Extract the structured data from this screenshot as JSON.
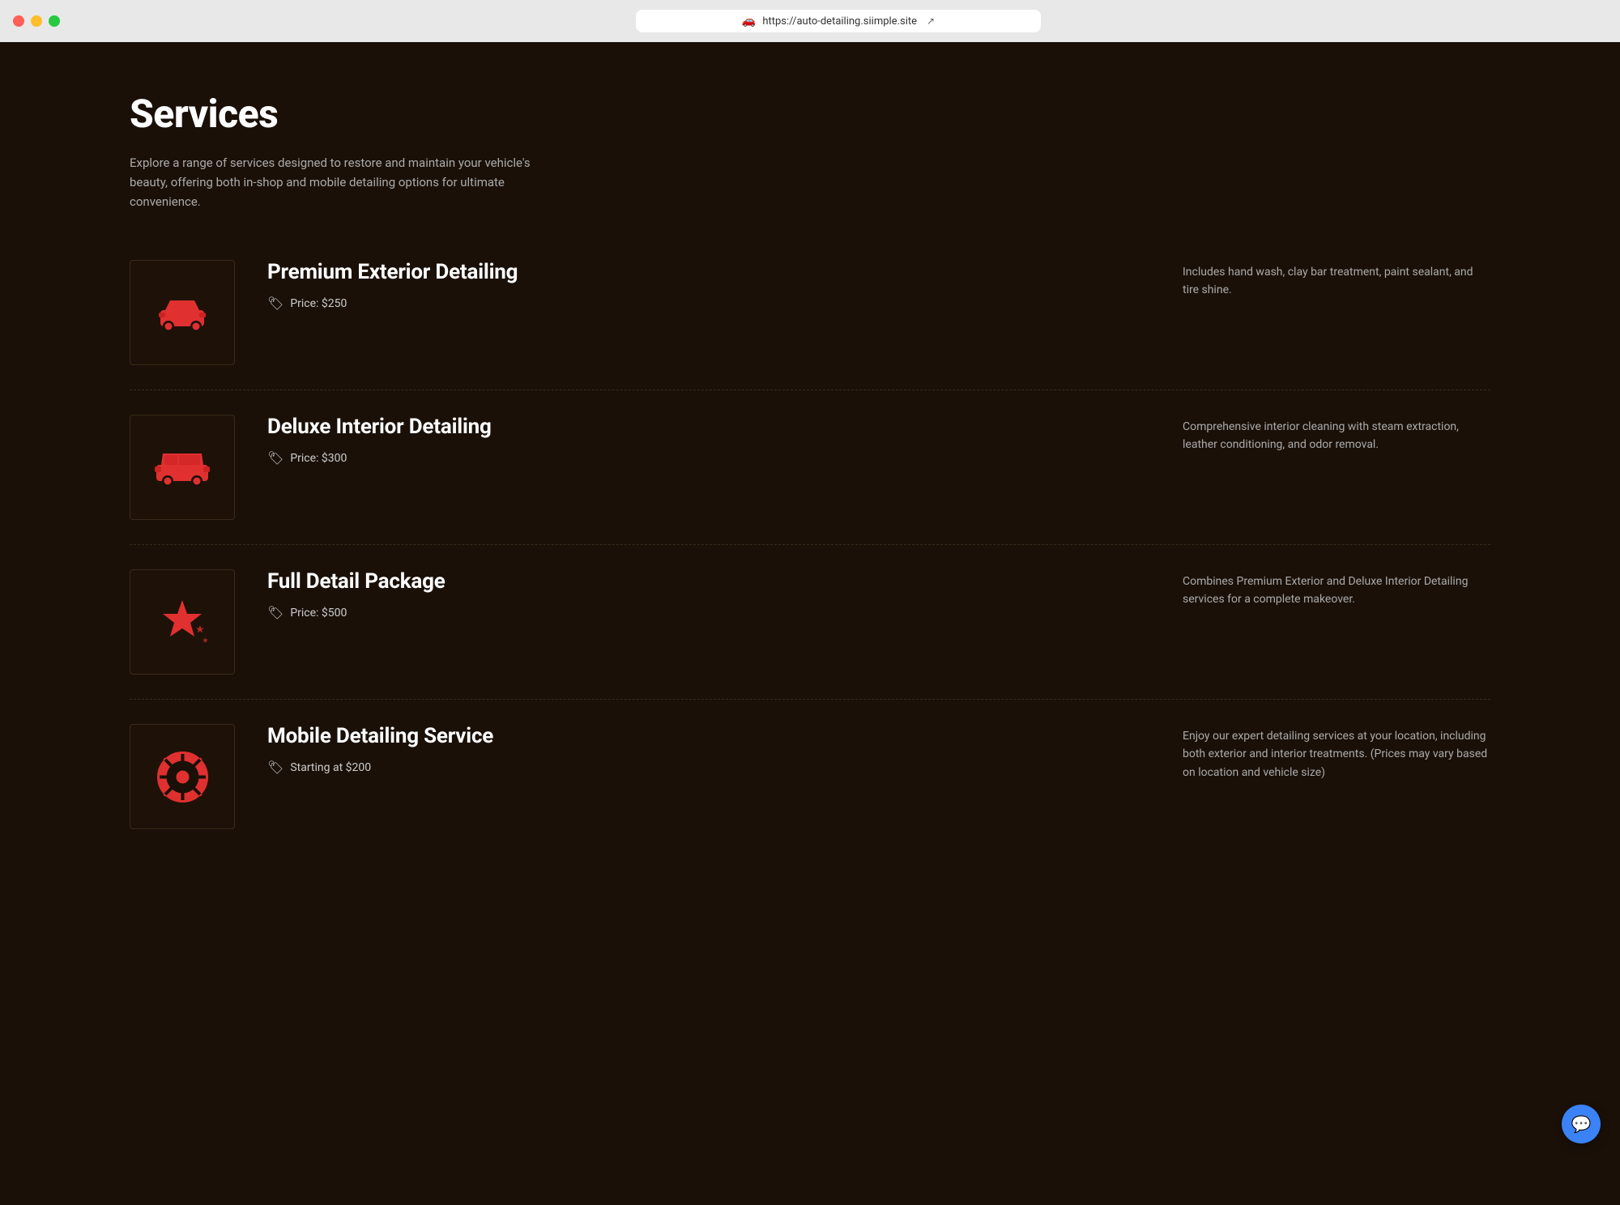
{
  "browser": {
    "url": "https://auto-detailing.siimple.site",
    "favicon": "🚗"
  },
  "page": {
    "title": "Services",
    "description": "Explore a range of services designed to restore and maintain your vehicle's beauty, offering both in-shop and mobile detailing options for ultimate convenience."
  },
  "services": [
    {
      "id": "premium-exterior",
      "name": "Premium Exterior Detailing",
      "price_label": "Price: $250",
      "price_prefix": "🏷",
      "description": "Includes hand wash, clay bar treatment, paint sealant, and tire shine.",
      "icon_type": "car"
    },
    {
      "id": "deluxe-interior",
      "name": "Deluxe Interior Detailing",
      "price_label": "Price: $300",
      "price_prefix": "🏷",
      "description": "Comprehensive interior cleaning with steam extraction, leather conditioning, and odor removal.",
      "icon_type": "suv"
    },
    {
      "id": "full-detail",
      "name": "Full Detail Package",
      "price_label": "Price: $500",
      "price_prefix": "🏷",
      "description": "Combines Premium Exterior and Deluxe Interior Detailing services for a complete makeover.",
      "icon_type": "star"
    },
    {
      "id": "mobile-detailing",
      "name": "Mobile Detailing Service",
      "price_label": "Starting at $200",
      "price_prefix": "🏷",
      "description": "Enjoy our expert detailing services at your location, including both exterior and interior treatments. (Prices may vary based on location and vehicle size)",
      "icon_type": "wheel"
    }
  ],
  "chat": {
    "label": "💬"
  }
}
